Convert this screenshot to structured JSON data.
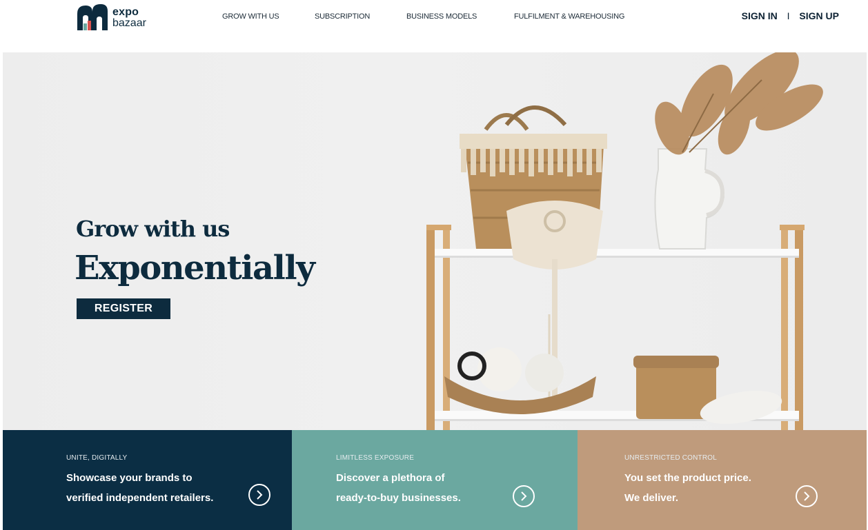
{
  "header": {
    "logo": {
      "line1": "expo",
      "line2": "bazaar"
    },
    "nav": [
      {
        "label": "GROW WITH US"
      },
      {
        "label": "SUBSCRIPTION"
      },
      {
        "label": "BUSINESS MODELS"
      },
      {
        "label": "FULFILMENT & WAREHOUSING"
      }
    ],
    "sign_in": "SIGN IN",
    "separator": "I",
    "sign_up": "SIGN UP"
  },
  "hero": {
    "title_line1": "Grow with us",
    "title_line2": "Exponentially",
    "register_label": "REGISTER"
  },
  "features": [
    {
      "eyebrow": "UNITE, DIGITALLY",
      "line1": "Showcase your brands to",
      "line2": "verified independent retailers.",
      "icon": "chevron-right-circle-icon",
      "color": "#0b2e44"
    },
    {
      "eyebrow": "LIMITLESS EXPOSURE",
      "line1": "Discover a plethora of",
      "line2": "ready-to-buy businesses.",
      "icon": "chevron-right-circle-icon",
      "color": "#6ba8a0"
    },
    {
      "eyebrow": "UNRESTRICTED CONTROL",
      "line1": "You set the product price.",
      "line2": "We deliver.",
      "icon": "chevron-right-circle-icon",
      "color": "#bf9b7c"
    }
  ],
  "colors": {
    "brand_navy": "#0d2b3e",
    "teal": "#6ba8a0",
    "tan": "#bf9b7c"
  }
}
